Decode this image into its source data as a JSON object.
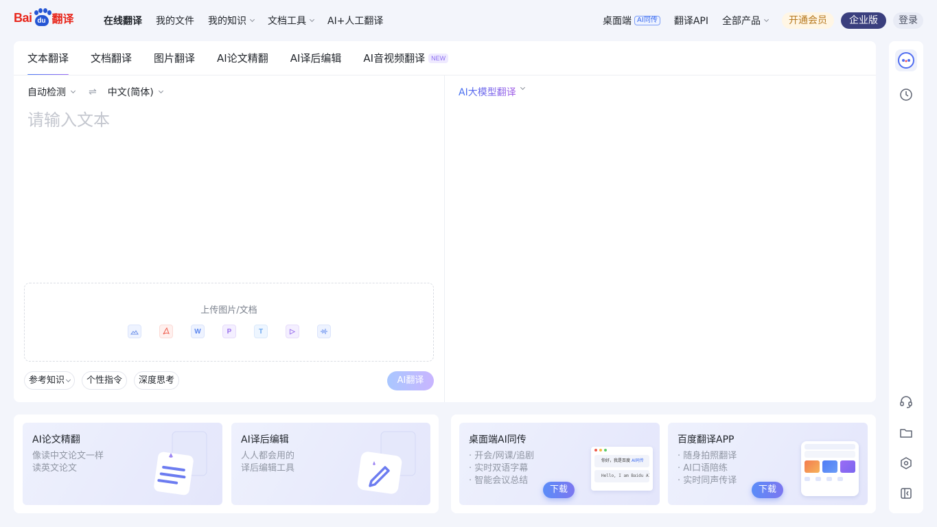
{
  "brand": {
    "bai": "Bai",
    "du": "du",
    "name": "翻译"
  },
  "nav": {
    "items": [
      {
        "label": "在线翻译"
      },
      {
        "label": "我的文件"
      },
      {
        "label": "我的知识"
      },
      {
        "label": "文档工具"
      },
      {
        "label": "AI+人工翻译"
      }
    ],
    "right": {
      "desktop": "桌面端",
      "desktop_tag": "AI同传",
      "api": "翻译API",
      "products": "全部产品",
      "vip": "开通会员",
      "enterprise": "企业版",
      "login": "登录"
    }
  },
  "tabs": [
    {
      "label": "文本翻译"
    },
    {
      "label": "文档翻译"
    },
    {
      "label": "图片翻译"
    },
    {
      "label": "AI论文精翻"
    },
    {
      "label": "AI译后编辑"
    },
    {
      "label": "AI音视频翻译",
      "badge": "NEW"
    }
  ],
  "source": {
    "from_lang": "自动检测",
    "to_lang": "中文(简体)",
    "placeholder": "请输入文本",
    "upload_label": "上传图片/文档",
    "file_types": [
      "image-icon",
      "pdf-icon",
      "word-icon",
      "ppt-icon",
      "txt-icon",
      "video-icon",
      "audio-icon"
    ],
    "options": [
      "参考知识",
      "个性指令",
      "深度思考"
    ],
    "translate_button": "AI翻译"
  },
  "target": {
    "model": "AI大模型翻译"
  },
  "promos": {
    "left": [
      {
        "title": "AI论文精翻",
        "lines": [
          "像读中文论文一样",
          "读英文论文"
        ]
      },
      {
        "title": "AI译后编辑",
        "lines": [
          "人人都会用的",
          "译后编辑工具"
        ]
      }
    ],
    "right": [
      {
        "title": "桌面端AI同传",
        "lines": [
          "· 开会/网课/追剧",
          "· 实时双语字幕",
          "· 智能会议总结"
        ],
        "button": "下载",
        "preview_text": "你好，我是百度",
        "preview_tag": "AI同传",
        "preview_en": "Hello, I am Baidu AI"
      },
      {
        "title": "百度翻译APP",
        "lines": [
          "· 随身拍照翻译",
          "· AI口语陪练",
          "· 实时同声传译"
        ],
        "button": "下载"
      }
    ]
  },
  "colors": {
    "accent": "#3d6cf0",
    "brand_red": "#e8261b",
    "enterprise": "#3a3f7e"
  }
}
